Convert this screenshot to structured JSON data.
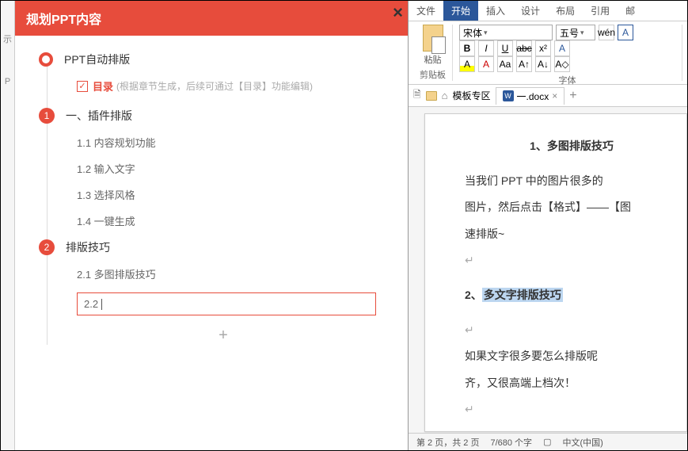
{
  "left_edge": {
    "hint1": "示",
    "hint2": "P"
  },
  "panel": {
    "title": "规划PPT内容",
    "root": "PPT自动排版",
    "toc_checked": true,
    "toc_label": "目录",
    "toc_desc": "(根据章节生成，后续可通过【目录】功能编辑)",
    "section1": {
      "num": "1",
      "title": "一、插件排版",
      "items": [
        "1.1 内容规划功能",
        "1.2 输入文字",
        "1.3 选择风格",
        "1.4 一键生成"
      ]
    },
    "section2": {
      "num": "2",
      "title": "排版技巧",
      "items": [
        "2.1 多图排版技巧"
      ],
      "editing": "2.2"
    },
    "add": "+"
  },
  "word": {
    "tabs": [
      "文件",
      "开始",
      "插入",
      "设计",
      "布局",
      "引用",
      "邮"
    ],
    "active_tab": 1,
    "font_name": "宋体",
    "font_size": "五号",
    "group_clipboard": "剪贴板",
    "paste_label": "粘贴",
    "group_font": "字体",
    "tabbar": {
      "template": "模板专区",
      "doc": "一.docx"
    },
    "doc": {
      "h1": "1、多图排版技巧",
      "p1a": "当我们 PPT 中的图片很多的",
      "p1b": "图片，然后点击【格式】——【图",
      "p1c": "速排版~",
      "h2_prefix": "2、",
      "h2_hl": "多文字排版技巧",
      "p2a": "如果文字很多要怎么排版呢",
      "p2b": "齐，又很高端上档次！"
    },
    "status": {
      "pages": "第 2 页，共 2 页",
      "words": "7/680 个字",
      "lang": "中文(中国)"
    }
  }
}
